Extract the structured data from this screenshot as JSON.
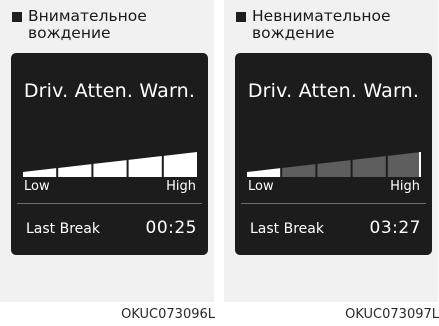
{
  "panels": [
    {
      "heading": "Внимательное вождение",
      "screen": {
        "title": "Driv. Atten. Warn.",
        "level_low_label": "Low",
        "level_high_label": "High",
        "level_fraction": 1.0,
        "break_label": "Last Break",
        "break_time": "00:25"
      },
      "figure_code": "OKUC073096L"
    },
    {
      "heading": "Невнимательное вождение",
      "screen": {
        "title": "Driv. Atten. Warn.",
        "level_low_label": "Low",
        "level_high_label": "High",
        "level_fraction": 0.2,
        "break_label": "Last Break",
        "break_time": "03:27"
      },
      "figure_code": "OKUC073097L"
    }
  ],
  "colors": {
    "panel_bg": "#f1f1f1",
    "screen_bg": "#1c1c1c",
    "segment_active": "#ffffff",
    "segment_inactive": "#5e5e5e",
    "text_light": "#ffffff",
    "text_dark": "#1a1a1a"
  },
  "icons": {
    "heading_marker": "square-bullet-icon"
  }
}
